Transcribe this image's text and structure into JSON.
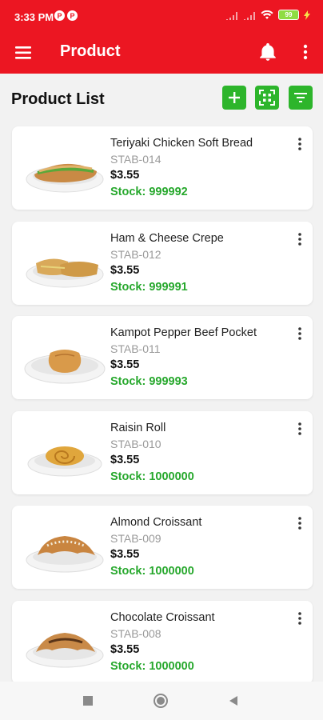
{
  "status": {
    "time": "3:33 PM",
    "app_icon_1": "P",
    "app_icon_2": "P",
    "battery": "99"
  },
  "appbar": {
    "title": "Product",
    "menu_icon": "hamburger-menu-icon",
    "bell_icon": "bell-icon",
    "more_icon": "more-vert-icon"
  },
  "header": {
    "title": "Product List",
    "add_icon": "plus-icon",
    "scan_icon": "qr-scan-icon",
    "filter_icon": "filter-icon"
  },
  "colors": {
    "primary": "#ec1622",
    "green": "#2db52b",
    "stock": "#27a82d"
  },
  "products": [
    {
      "name": "Teriyaki Chicken Soft Bread",
      "code": "STAB-014",
      "price": "$3.55",
      "stock": "Stock: 999992",
      "image": "sandwich"
    },
    {
      "name": "Ham & Cheese Crepe",
      "code": "STAB-012",
      "price": "$3.55",
      "stock": "Stock: 999991",
      "image": "crepe"
    },
    {
      "name": "Kampot Pepper Beef Pocket",
      "code": "STAB-011",
      "price": "$3.55",
      "stock": "Stock: 999993",
      "image": "pocket"
    },
    {
      "name": "Raisin Roll",
      "code": "STAB-010",
      "price": "$3.55",
      "stock": "Stock: 1000000",
      "image": "roll"
    },
    {
      "name": "Almond Croissant",
      "code": "STAB-009",
      "price": "$3.55",
      "stock": "Stock: 1000000",
      "image": "almond-croissant"
    },
    {
      "name": "Chocolate Croissant",
      "code": "STAB-008",
      "price": "$3.55",
      "stock": "Stock: 1000000",
      "image": "chocolate-croissant"
    }
  ],
  "navbar": {
    "recent_icon": "square-recent-icon",
    "home_icon": "circle-home-icon",
    "back_icon": "triangle-back-icon"
  }
}
